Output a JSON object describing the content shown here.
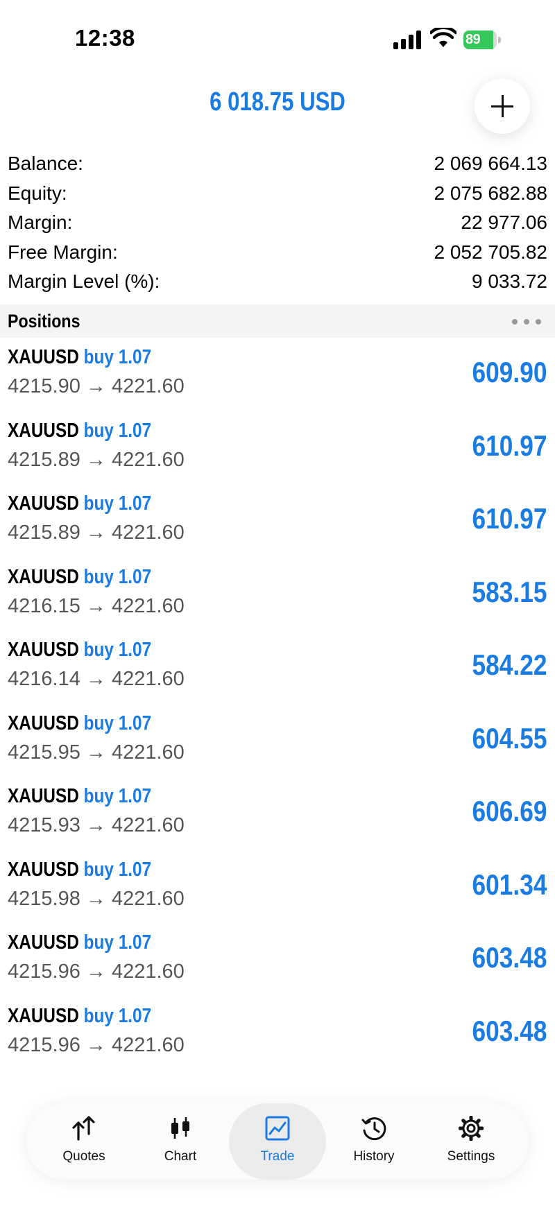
{
  "status_bar": {
    "time": "12:38",
    "battery_percent": "89",
    "battery_level": 0.89,
    "battery_color": "#34c759"
  },
  "header": {
    "total_profit": "6 018.75 USD",
    "accent_color": "#1a7be0",
    "add_icon": "plus-icon"
  },
  "account": [
    {
      "label": "Balance:",
      "value": "2 069 664.13"
    },
    {
      "label": "Equity:",
      "value": "2 075 682.88"
    },
    {
      "label": "Margin:",
      "value": "22 977.06"
    },
    {
      "label": "Free Margin:",
      "value": "2 052 705.82"
    },
    {
      "label": "Margin Level (%):",
      "value": "9 033.72"
    }
  ],
  "positions_header": {
    "title": "Positions",
    "menu_icon": "more-dots-icon"
  },
  "positions": [
    {
      "symbol": "XAUUSD",
      "type": "buy 1.07",
      "prices": "4215.90 → 4221.60",
      "profit": "609.90"
    },
    {
      "symbol": "XAUUSD",
      "type": "buy 1.07",
      "prices": "4215.89 → 4221.60",
      "profit": "610.97"
    },
    {
      "symbol": "XAUUSD",
      "type": "buy 1.07",
      "prices": "4215.89 → 4221.60",
      "profit": "610.97"
    },
    {
      "symbol": "XAUUSD",
      "type": "buy 1.07",
      "prices": "4216.15 → 4221.60",
      "profit": "583.15"
    },
    {
      "symbol": "XAUUSD",
      "type": "buy 1.07",
      "prices": "4216.14 → 4221.60",
      "profit": "584.22"
    },
    {
      "symbol": "XAUUSD",
      "type": "buy 1.07",
      "prices": "4215.95 → 4221.60",
      "profit": "604.55"
    },
    {
      "symbol": "XAUUSD",
      "type": "buy 1.07",
      "prices": "4215.93 → 4221.60",
      "profit": "606.69"
    },
    {
      "symbol": "XAUUSD",
      "type": "buy 1.07",
      "prices": "4215.98 → 4221.60",
      "profit": "601.34"
    },
    {
      "symbol": "XAUUSD",
      "type": "buy 1.07",
      "prices": "4215.96 → 4221.60",
      "profit": "603.48"
    },
    {
      "symbol": "XAUUSD",
      "type": "buy 1.07",
      "prices": "4215.96 → 4221.60",
      "profit": "603.48"
    }
  ],
  "tabs": [
    {
      "label": "Quotes",
      "icon": "quotes-arrows-icon"
    },
    {
      "label": "Chart",
      "icon": "candlestick-chart-icon"
    },
    {
      "label": "Trade",
      "icon": "trade-chart-icon",
      "active": true
    },
    {
      "label": "History",
      "icon": "history-clock-icon"
    },
    {
      "label": "Settings",
      "icon": "gear-icon"
    }
  ]
}
